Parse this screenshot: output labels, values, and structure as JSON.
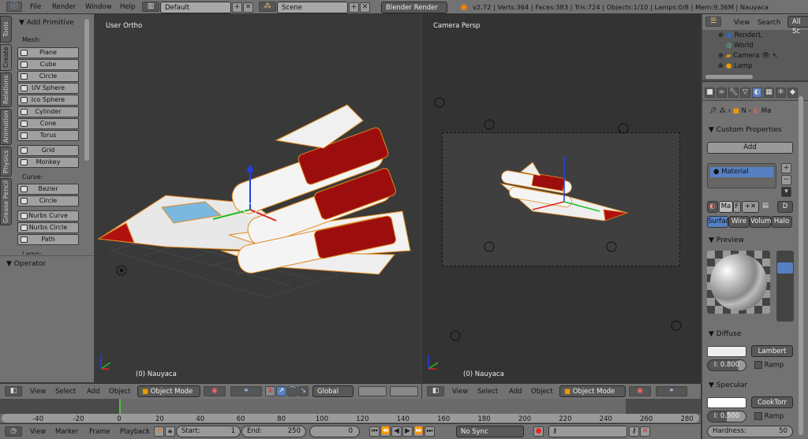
{
  "topbar": {
    "menus": [
      "File",
      "Render",
      "Window",
      "Help"
    ],
    "layout": "Default",
    "scene": "Scene",
    "engine": "Blender Render",
    "stats": "v2.72 | Verts:364 | Faces:383 | Tris:724 | Objects:1/10 | Lamps:0/8 | Mem:9.36M | Nauyaca"
  },
  "toolshelf": {
    "tabs": [
      "Tools",
      "Create",
      "Relations",
      "Animation",
      "Physics",
      "Grease Pencil"
    ],
    "panel": "Add Primitive",
    "mesh_label": "Mesh:",
    "mesh": [
      "Plane",
      "Cube",
      "Circle",
      "UV Sphere",
      "Ico Sphere",
      "Cylinder",
      "Cone",
      "Torus"
    ],
    "mesh2": [
      "Grid",
      "Monkey"
    ],
    "curve_label": "Curve:",
    "curve": [
      "Bezier",
      "Circle"
    ],
    "curve2": [
      "Nurbs Curve",
      "Nurbs Circle",
      "Path"
    ],
    "lamp_label": "Lamp:",
    "operator": "Operator"
  },
  "viewport_left": {
    "title": "User Ortho",
    "object": "(0) Nauyaca"
  },
  "viewport_right": {
    "title": "Camera Persp",
    "object": "(0) Nauyaca"
  },
  "view_header": {
    "menus": [
      "View",
      "Select",
      "Add",
      "Object"
    ],
    "mode": "Object Mode",
    "orientation": "Global"
  },
  "outliner": {
    "menus": [
      "View",
      "Search"
    ],
    "filter": "All Sc",
    "items": [
      "RenderL",
      "World",
      "Camera",
      "Lamp"
    ]
  },
  "properties": {
    "breadcrumb": [
      "N",
      "Ma"
    ],
    "custom_props": "Custom Properties",
    "add": "Add",
    "material": "Material",
    "mat_name": "Ma",
    "f": "F",
    "d": "D",
    "tabs": [
      "Surfac",
      "Wire",
      "Volum",
      "Halo"
    ],
    "preview": "Preview",
    "diffuse": "Diffuse",
    "diffuse_shader": "Lambert",
    "diffuse_intensity": "I: 0.800",
    "ramp": "Ramp",
    "specular": "Specular",
    "specular_shader": "CookTorr",
    "specular_intensity": "I: 0.500",
    "hardness_label": "Hardness:",
    "hardness": "50"
  },
  "timeline": {
    "ticks": [
      "-40",
      "-20",
      "0",
      "20",
      "40",
      "60",
      "80",
      "100",
      "120",
      "140",
      "160",
      "180",
      "200",
      "220",
      "240",
      "260",
      "280"
    ],
    "current_frame": 0,
    "menus": [
      "View",
      "Marker",
      "Frame",
      "Playback"
    ],
    "start_label": "Start:",
    "start": "1",
    "end_label": "End:",
    "end": "250",
    "frame": "0",
    "sync": "No Sync"
  },
  "colors": {
    "accent": "#5680c2",
    "playhead": "#4ec23a"
  }
}
